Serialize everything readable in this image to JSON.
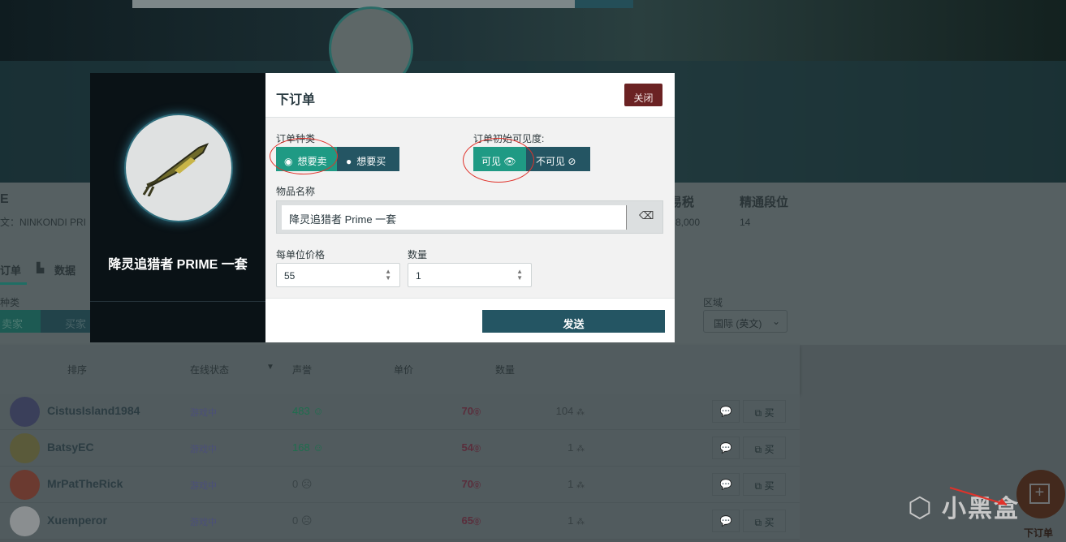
{
  "page": {
    "item_subtitle_prefix": "文：NINKONDI PRI",
    "header_cut": "E",
    "stats": [
      {
        "label": "易税",
        "value": "8,000"
      },
      {
        "label": "精通段位",
        "value": "14"
      }
    ],
    "tabs": [
      {
        "label": "订单"
      },
      {
        "label": "数据",
        "icon": "chart-icon"
      }
    ],
    "type_label": "种类",
    "type_options": [
      "卖家",
      "买家"
    ],
    "region_label": "区域",
    "region_value": "国际 (英文)",
    "table_headers": [
      "排序",
      "在线状态",
      "声誉",
      "单价",
      "数量"
    ],
    "rows": [
      {
        "name": "CistusIsland1984",
        "status": "游戏中",
        "rep": "483",
        "rep_icon": "smile-icon",
        "price": "70",
        "qty": "104",
        "buy": "买"
      },
      {
        "name": "BatsyEC",
        "status": "游戏中",
        "rep": "168",
        "rep_icon": "smile-icon",
        "price": "54",
        "qty": "1",
        "buy": "买"
      },
      {
        "name": "MrPatTheRick",
        "status": "游戏中",
        "rep": "0",
        "rep_icon": "neutral-face-icon",
        "price": "70",
        "qty": "1",
        "buy": "买"
      },
      {
        "name": "Xuemperor",
        "status": "游戏中",
        "rep": "0",
        "rep_icon": "neutral-face-icon",
        "price": "65",
        "qty": "1",
        "buy": "买"
      }
    ],
    "fab_label": "下订单",
    "watermark": "小黑盒"
  },
  "modal": {
    "item_name": "降灵追猎者 PRIME 一套",
    "title": "下订单",
    "close": "关闭",
    "order_type_label": "订单种类",
    "order_types": [
      "想要卖",
      "想要买"
    ],
    "order_type_selected": "想要卖",
    "visibility_label": "订单初始可见度:",
    "visibility_options": [
      "可见",
      "不可见"
    ],
    "visibility_selected": "可见",
    "item_name_label": "物品名称",
    "item_name_value": "降灵追猎者 Prime 一套",
    "price_label": "每单位价格",
    "price_value": "55",
    "qty_label": "数量",
    "qty_value": "1",
    "send": "发送"
  },
  "colors": {
    "accent": "#1f9a84",
    "dark_teal": "#245563",
    "close": "#6b2223",
    "price": "#5a2e3c"
  }
}
